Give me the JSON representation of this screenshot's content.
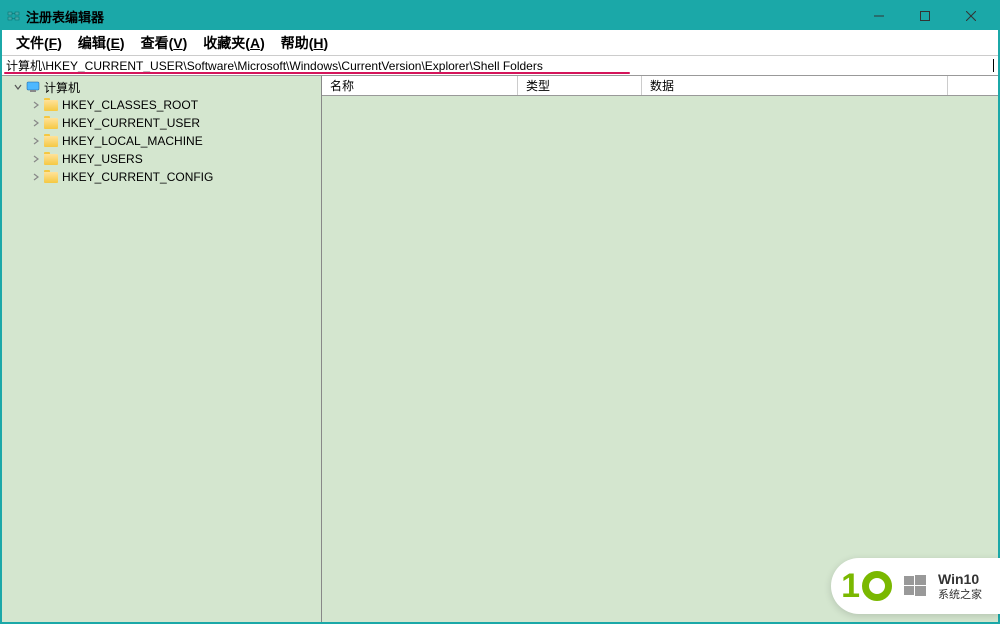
{
  "window": {
    "title": "注册表编辑器"
  },
  "menu": {
    "file": "文件(F)",
    "edit": "编辑(E)",
    "view": "查看(V)",
    "favorites": "收藏夹(A)",
    "help": "帮助(H)"
  },
  "addressbar": {
    "path": "计算机\\HKEY_CURRENT_USER\\Software\\Microsoft\\Windows\\CurrentVersion\\Explorer\\Shell Folders"
  },
  "tree": {
    "root": "计算机",
    "children": [
      "HKEY_CLASSES_ROOT",
      "HKEY_CURRENT_USER",
      "HKEY_LOCAL_MACHINE",
      "HKEY_USERS",
      "HKEY_CURRENT_CONFIG"
    ]
  },
  "columns": {
    "name": "名称",
    "type": "类型",
    "data": "数据"
  },
  "watermark": {
    "title": "Win10",
    "subtitle": "系统之家"
  }
}
